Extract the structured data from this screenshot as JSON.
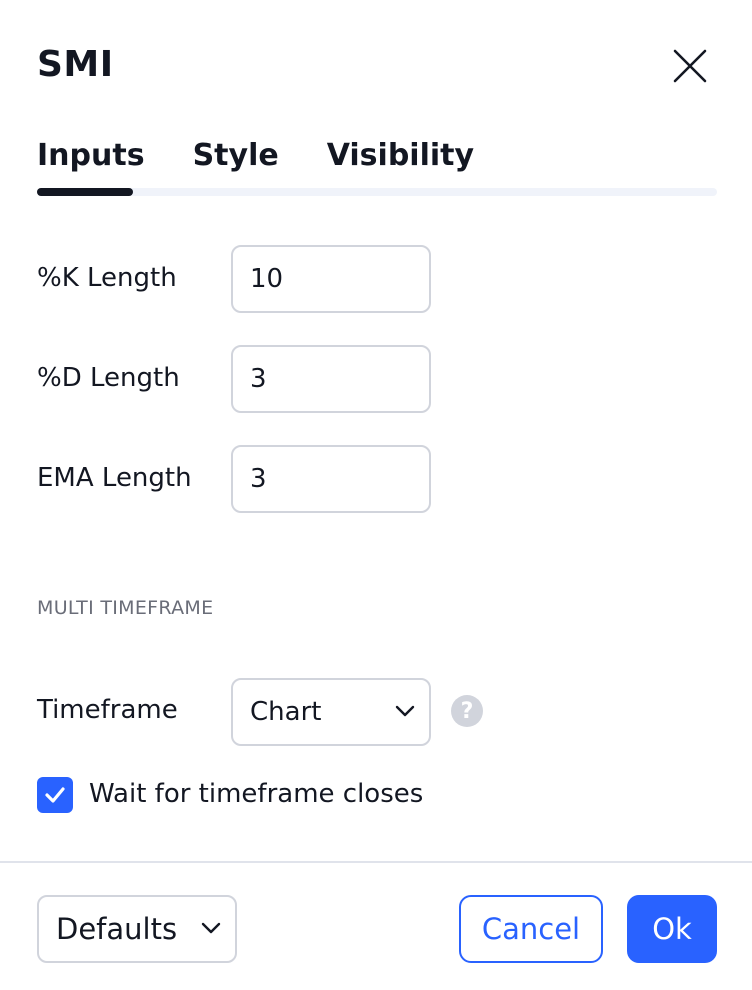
{
  "dialog": {
    "title": "SMI",
    "close_icon": "close-icon"
  },
  "tabs": [
    {
      "label": "Inputs",
      "active": true
    },
    {
      "label": "Style",
      "active": false
    },
    {
      "label": "Visibility",
      "active": false
    }
  ],
  "inputs": {
    "k_length": {
      "label": "%K Length",
      "value": "10"
    },
    "d_length": {
      "label": "%D Length",
      "value": "3"
    },
    "ema_length": {
      "label": "EMA Length",
      "value": "3"
    }
  },
  "multi_timeframe": {
    "section_title": "MULTI TIMEFRAME",
    "timeframe_label": "Timeframe",
    "timeframe_value": "Chart",
    "help_icon": "question-icon",
    "wait_checkbox": {
      "label": "Wait for timeframe closes",
      "checked": true
    }
  },
  "footer": {
    "defaults_label": "Defaults",
    "cancel_label": "Cancel",
    "ok_label": "Ok"
  },
  "colors": {
    "accent": "#2962ff",
    "text": "#131722",
    "border": "#d1d4dc",
    "muted": "#6a6d78"
  }
}
